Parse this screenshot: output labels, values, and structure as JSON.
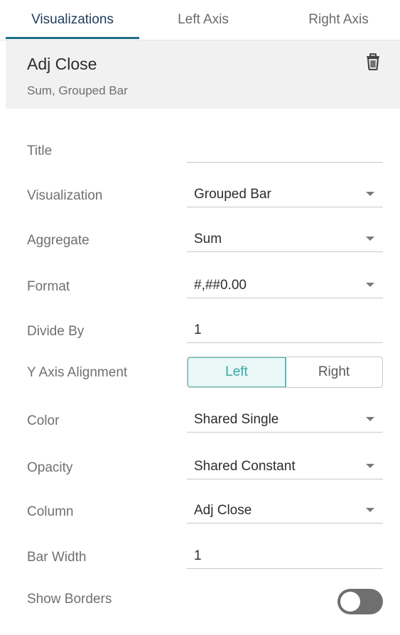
{
  "tabs": [
    {
      "label": "Visualizations",
      "active": true
    },
    {
      "label": "Left Axis",
      "active": false
    },
    {
      "label": "Right Axis",
      "active": false
    }
  ],
  "header": {
    "title": "Adj Close",
    "subtitle": "Sum, Grouped Bar",
    "delete_icon": "trash-icon"
  },
  "fields": {
    "title": {
      "label": "Title",
      "value": ""
    },
    "visualization": {
      "label": "Visualization",
      "value": "Grouped Bar"
    },
    "aggregate": {
      "label": "Aggregate",
      "value": "Sum"
    },
    "format": {
      "label": "Format",
      "value": "#,##0.00"
    },
    "divide_by": {
      "label": "Divide By",
      "value": "1"
    },
    "y_axis_alignment": {
      "label": "Y Axis Alignment",
      "options": [
        "Left",
        "Right"
      ],
      "selected": "Left"
    },
    "color": {
      "label": "Color",
      "value": "Shared Single"
    },
    "opacity": {
      "label": "Opacity",
      "value": "Shared Constant"
    },
    "column": {
      "label": "Column",
      "value": "Adj Close"
    },
    "bar_width": {
      "label": "Bar Width",
      "value": "1"
    },
    "show_borders": {
      "label": "Show Borders",
      "on": false
    }
  },
  "colors": {
    "accent": "#1e6f87",
    "segment_selected": "#3aa7a7",
    "toggle_off": "#6f6f6f"
  }
}
